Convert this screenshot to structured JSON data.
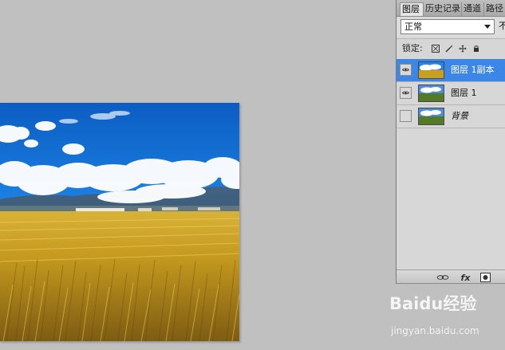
{
  "workspace": {
    "background_color": "#c0c0c0"
  },
  "canvas": {
    "scene": "rice-field-landscape"
  },
  "layers_panel": {
    "tabs": [
      {
        "label": "图层",
        "active": true
      },
      {
        "label": "历史记录",
        "active": false
      },
      {
        "label": "通道",
        "active": false
      },
      {
        "label": "路径",
        "active": false
      }
    ],
    "blend_mode": "正常",
    "right_truncated_text": "不",
    "lock_label": "锁定:",
    "lock_icons": [
      "transparent-lock-icon",
      "paint-lock-icon",
      "move-lock-icon",
      "all-lock-icon"
    ],
    "layers": [
      {
        "name": "图层 1副本",
        "visible": true,
        "selected": true,
        "thumbnail": "rice-field-thumbnail-color"
      },
      {
        "name": "图层 1",
        "visible": true,
        "selected": false,
        "thumbnail": "rice-field-thumbnail-green"
      },
      {
        "name": "背景",
        "visible": false,
        "selected": false,
        "thumbnail": "rice-field-thumbnail-green",
        "italic": true
      }
    ],
    "bottom_icons": [
      "link-layers-icon",
      "fx-icon",
      "mask-icon"
    ]
  },
  "watermark": {
    "brand": "Baidu经验",
    "url": "jingyan.baidu.com"
  }
}
